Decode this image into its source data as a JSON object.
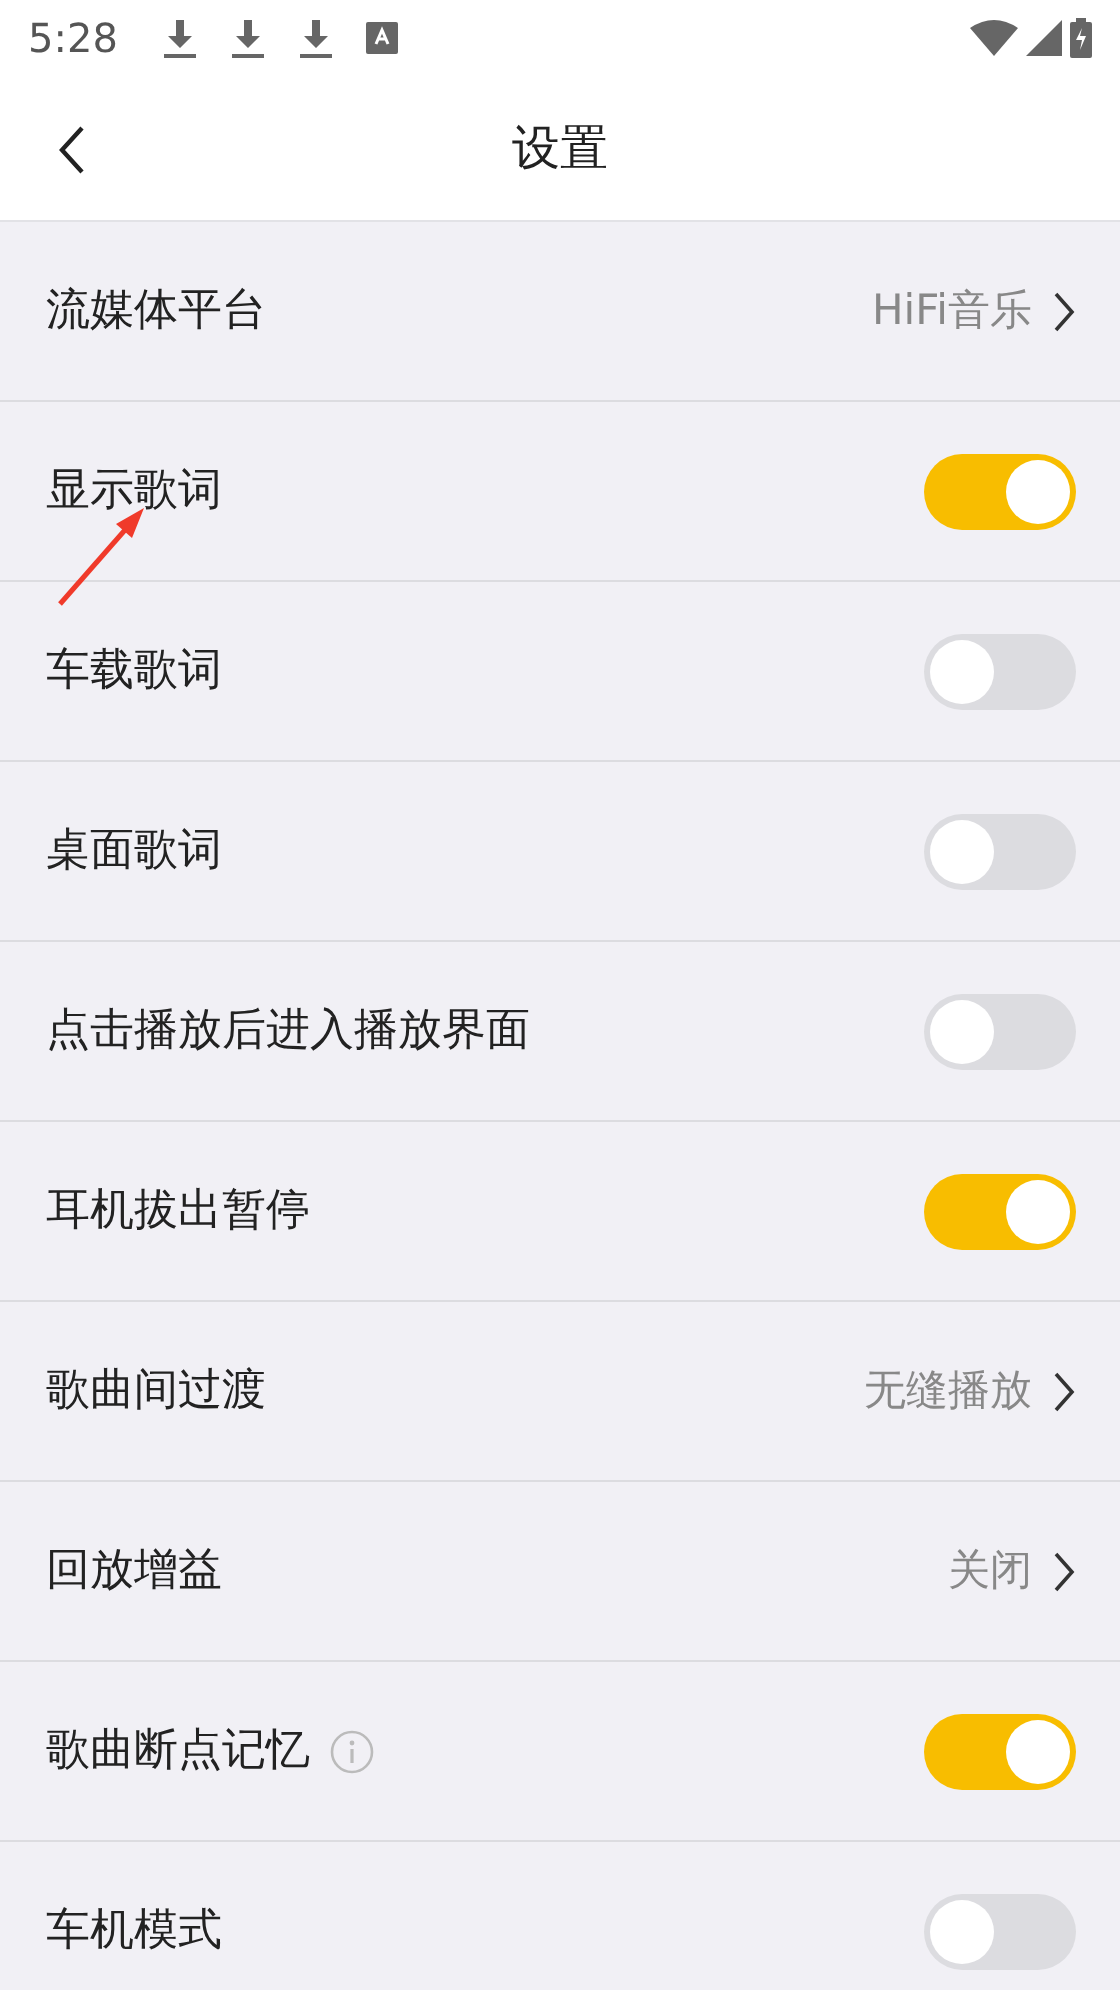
{
  "status_bar": {
    "time": "5:28"
  },
  "header": {
    "title": "设置"
  },
  "rows": [
    {
      "kind": "link",
      "label": "流媒体平台",
      "value": "HiFi音乐"
    },
    {
      "kind": "toggle",
      "label": "显示歌词",
      "on": true
    },
    {
      "kind": "toggle",
      "label": "车载歌词",
      "on": false
    },
    {
      "kind": "toggle",
      "label": "桌面歌词",
      "on": false
    },
    {
      "kind": "toggle",
      "label": "点击播放后进入播放界面",
      "on": false
    },
    {
      "kind": "toggle",
      "label": "耳机拔出暂停",
      "on": true
    },
    {
      "kind": "link",
      "label": "歌曲间过渡",
      "value": "无缝播放"
    },
    {
      "kind": "link",
      "label": "回放增益",
      "value": "关闭"
    },
    {
      "kind": "toggle",
      "label": "歌曲断点记忆",
      "on": true,
      "info": true
    },
    {
      "kind": "toggle",
      "label": "车机模式",
      "on": false
    }
  ]
}
